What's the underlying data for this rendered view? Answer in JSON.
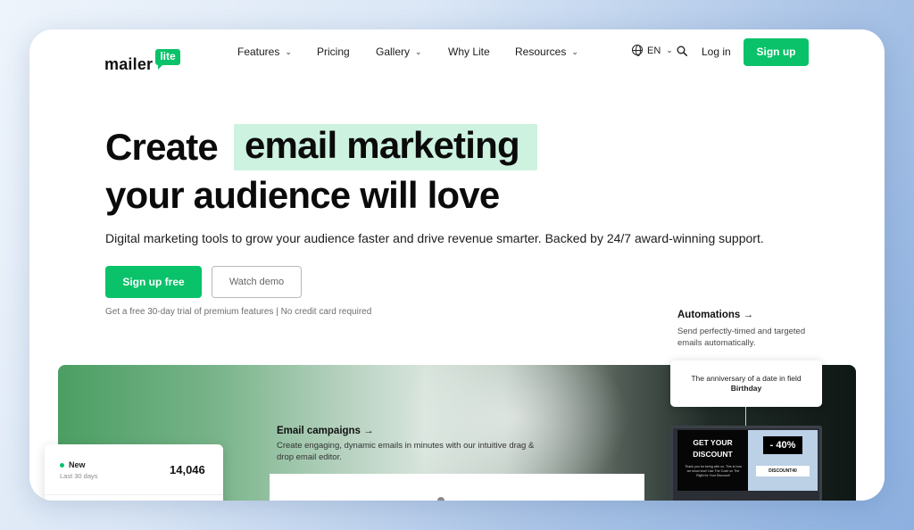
{
  "logo": {
    "word": "mailer",
    "badge": "lite"
  },
  "nav": {
    "features": "Features",
    "pricing": "Pricing",
    "gallery": "Gallery",
    "why": "Why Lite",
    "resources": "Resources",
    "lang": "EN",
    "login": "Log in",
    "signup": "Sign up"
  },
  "hero": {
    "line1_prefix": "Create",
    "line1_highlight": "email marketing",
    "line2": "your audience will love",
    "subtitle": "Digital marketing tools to grow your audience faster and drive revenue smarter. Backed by 24/7 award-winning support.",
    "primary_cta": "Sign up free",
    "secondary_cta": "Watch demo",
    "fine_print": "Get a free 30-day trial of premium features | No credit card required"
  },
  "automations": {
    "title": "Automations →",
    "desc": "Send perfectly-timed and targeted emails automatically."
  },
  "campaigns": {
    "title": "Email campaigns →",
    "desc": "Create engaging, dynamic emails in minutes with our intuitive drag & drop email editor."
  },
  "stat_card": {
    "label": "New",
    "period": "Last 30 days",
    "value": "14,046"
  },
  "anniversary": {
    "text": "The anniversary of a date in field",
    "field": "Birthday"
  },
  "promo": {
    "title_line1": "GET YOUR",
    "title_line2": "DISCOUNT",
    "small": "Thank you for being with us. This is how we show love! Use The Code on The Right for Your Discount!",
    "percent": "- 40%",
    "code": "DISCOUNT40"
  },
  "colors": {
    "brand_green": "#09c269",
    "highlight": "#cdf2e0"
  },
  "icons": [
    "chevron-down-icon",
    "globe-icon",
    "search-icon",
    "arrow-right-icon"
  ]
}
